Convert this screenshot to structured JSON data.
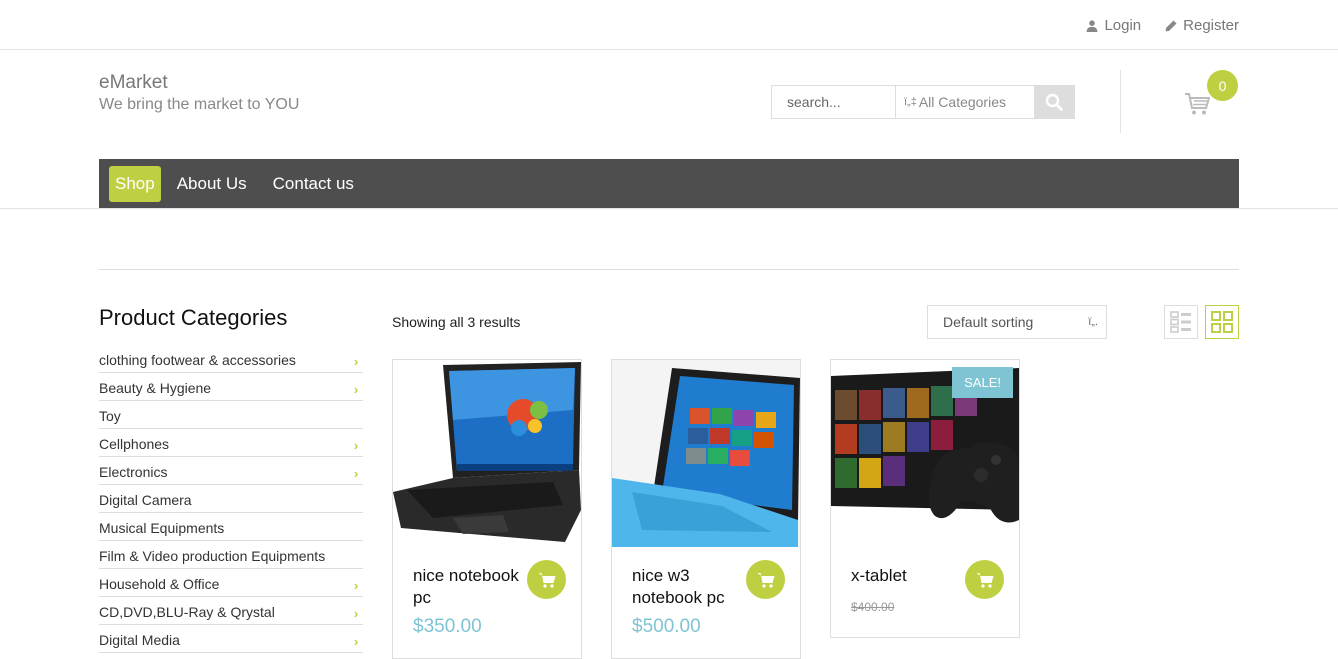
{
  "topbar": {
    "login": "Login",
    "register": "Register"
  },
  "brand": {
    "name": "eMarket",
    "tagline": "We bring the market to YOU"
  },
  "search": {
    "placeholder": "search...",
    "category_glyph": "ï„‡",
    "category": "All Categories"
  },
  "cart": {
    "count": "0"
  },
  "nav": {
    "items": [
      "Shop",
      "About Us",
      "Contact us"
    ],
    "active": "Shop"
  },
  "sidebar": {
    "title": "Product Categories",
    "categories": [
      {
        "label": "clothing footwear & accessories",
        "has_children": true
      },
      {
        "label": "Beauty & Hygiene",
        "has_children": true
      },
      {
        "label": "Toy",
        "has_children": false
      },
      {
        "label": "Cellphones",
        "has_children": true
      },
      {
        "label": "Electronics",
        "has_children": true
      },
      {
        "label": "Digital Camera",
        "has_children": false
      },
      {
        "label": "Musical Equipments",
        "has_children": false
      },
      {
        "label": "Film & Video production Equipments",
        "has_children": false
      },
      {
        "label": "Household & Office",
        "has_children": true
      },
      {
        "label": "CD,DVD,BLU-Ray & Qrystal",
        "has_children": true
      },
      {
        "label": "Digital Media",
        "has_children": true
      }
    ]
  },
  "results": {
    "text": "Showing all 3 results"
  },
  "sorting": {
    "selected": "Default sorting",
    "glyph": "ï„."
  },
  "products": [
    {
      "title": "nice notebook pc",
      "price": "$350.00",
      "old_price": "",
      "sale": "",
      "image": "laptop-image"
    },
    {
      "title": "nice w3 notebook pc",
      "price": "$500.00",
      "old_price": "",
      "sale": "",
      "image": "tablet-keyboard-image"
    },
    {
      "title": "x-tablet",
      "price": "",
      "old_price": "$400.00",
      "sale": "SALE!",
      "image": "tablet-gamepad-image"
    }
  ],
  "colors": {
    "accent": "#bed041",
    "price": "#7ec4d3",
    "nav_bg": "#4e4e4e"
  },
  "icons": [
    "user-icon",
    "pencil-icon",
    "search-icon",
    "cart-icon",
    "list-view-icon",
    "grid-view-icon",
    "chevron-right-icon"
  ]
}
